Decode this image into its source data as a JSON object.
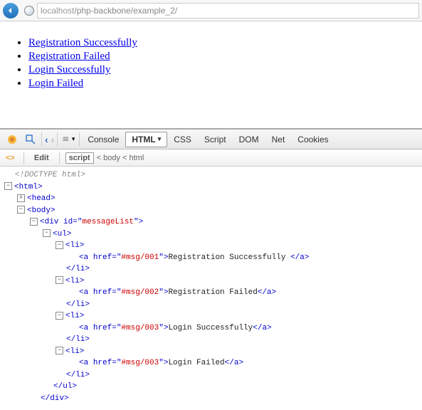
{
  "browser": {
    "url_host": "localhost",
    "url_path": "/php-backbone/example_2/"
  },
  "page": {
    "links": [
      {
        "text": "Registration Successfully"
      },
      {
        "text": "Registration Failed"
      },
      {
        "text": "Login Successfully"
      },
      {
        "text": "Login Failed"
      }
    ]
  },
  "firebug": {
    "tabs": {
      "console": "Console",
      "html": "HTML",
      "css": "CSS",
      "script": "Script",
      "dom": "DOM",
      "net": "Net",
      "cookies": "Cookies"
    },
    "subbar": {
      "edit": "Edit",
      "crumb_selected": "script",
      "crumb_rest": " < body < html"
    },
    "tree": {
      "doctype": "<!DOCTYPE html>",
      "html_open": "<html>",
      "head_open": "<head>",
      "body_open": "<body>",
      "div_open_pre": "<div ",
      "div_open_attr": "id",
      "div_open_eq": "=\"",
      "div_open_val": "messageList",
      "div_open_post": "\">",
      "ul_open": "<ul>",
      "li_open": "<li>",
      "a_open_pre": "<a ",
      "a_open_attr": "href",
      "a_open_eq": "=\"",
      "a_open_post": "\">",
      "a_close": "</a>",
      "li_close": "</li>",
      "ul_close": "</ul>",
      "div_close": "</div>",
      "items": [
        {
          "href": "#msg/001",
          "text": "Registration Successfully "
        },
        {
          "href": "#msg/002",
          "text": "Registration Failed"
        },
        {
          "href": "#msg/003",
          "text": "Login Successfully"
        },
        {
          "href": "#msg/003",
          "text": "Login Failed"
        }
      ]
    }
  }
}
